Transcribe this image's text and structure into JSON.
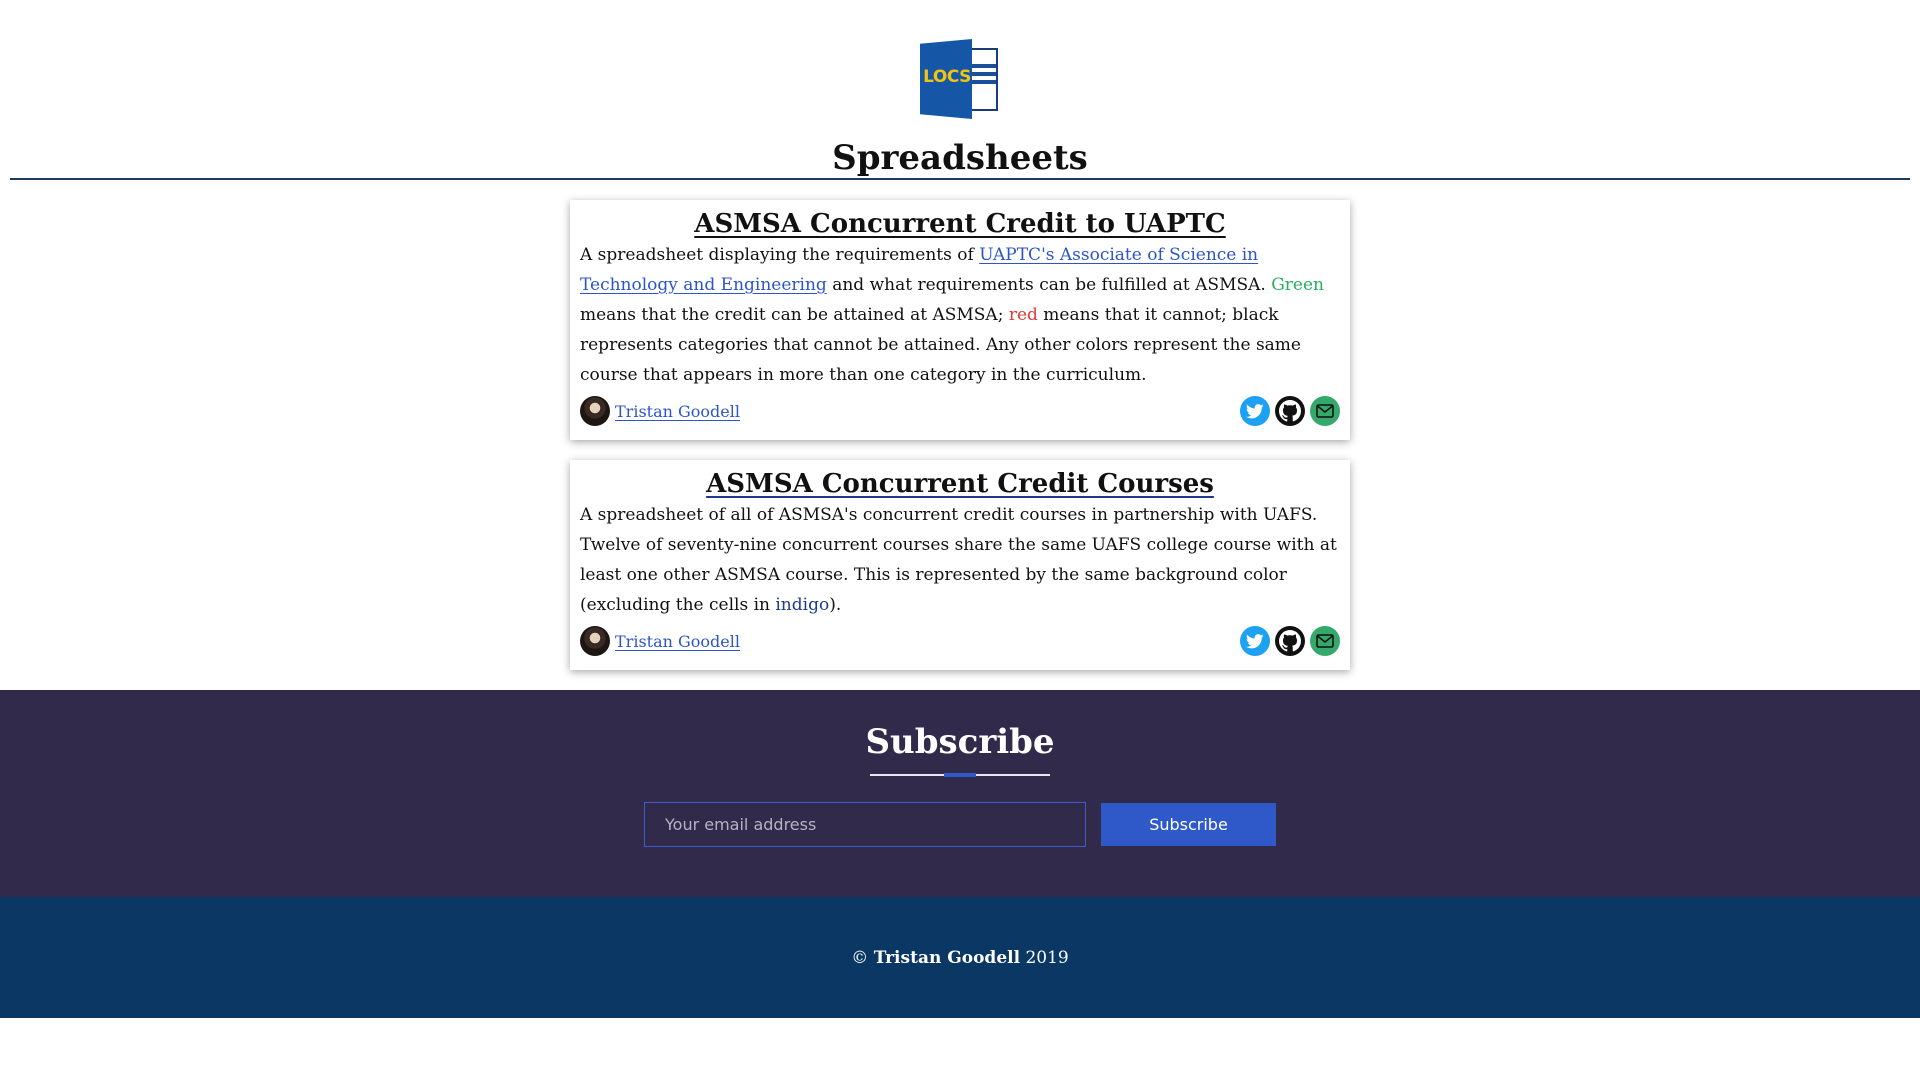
{
  "header": {
    "logo_text": "LOCS",
    "title": "Spreadsheets"
  },
  "cards": [
    {
      "title": "ASMSA Concurrent Credit to UAPTC",
      "text_1": "A spreadsheet displaying the requirements of ",
      "link": "UAPTC's Associate of Science in Technology and Engineering",
      "text_2": " and what requirements can be fulfilled at ASMSA. ",
      "green_word": "Green",
      "text_3": " means that the credit can be attained at ASMSA; ",
      "red_word": "red",
      "text_4": " means that it cannot; black represents categories that cannot be attained. Any other colors represent the same course that appears in more than one category in the curriculum.",
      "author": "Tristan Goodell",
      "social_icons": [
        "twitter-icon",
        "github-icon",
        "email-icon"
      ]
    },
    {
      "title": "ASMSA Concurrent Credit Courses",
      "text_1": "A spreadsheet of all of ASMSA's concurrent credit courses in partnership with UAFS. Twelve of seventy-nine concurrent courses share the same UAFS college course with at least one other ASMSA course. This is represented by the same background color (excluding the cells in ",
      "indigo_word": "indigo",
      "text_2": ").",
      "author": "Tristan Goodell",
      "social_icons": [
        "twitter-icon",
        "github-icon",
        "email-icon"
      ]
    }
  ],
  "subscribe": {
    "title": "Subscribe",
    "placeholder": "Your email address",
    "button": "Subscribe"
  },
  "footer": {
    "copyright": "©",
    "name": "Tristan Goodell",
    "year": "2019"
  },
  "colors": {
    "link": "#2d55c8",
    "green": "#27ae60",
    "red": "#e53935",
    "indigo": "#1f3a8a",
    "subscribe_bg": "#312a4a",
    "footer_bg": "#0a3763",
    "accent": "#2f59c9"
  }
}
